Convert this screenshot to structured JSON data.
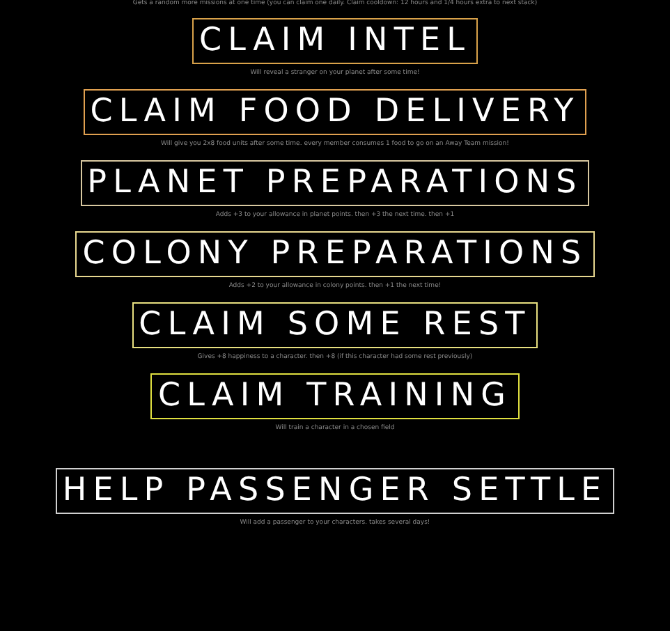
{
  "intro": "Gets a random more missions at one time (you can claim one daily. Claim cooldown: 12 hours and 1/4 hours extra to next stack)",
  "actions": [
    {
      "label": "CLAIM INTEL",
      "color": "#d9a24a",
      "description": "Will reveal a stranger on your planet after some time!"
    },
    {
      "label": "CLAIM FOOD DELIVERY",
      "color": "#e0a050",
      "description": "Will give you 2x8 food units after some time. every member consumes 1 food to go on an Away Team mission!"
    },
    {
      "label": "PLANET PREPARATIONS",
      "color": "#d8c8a0",
      "description": "Adds +3 to your allowance in planet points. then +3 the next time. then +1"
    },
    {
      "label": "COLONY PREPARATIONS",
      "color": "#e8d890",
      "description": "Adds +2 to your allowance in colony points. then +1 the next time!"
    },
    {
      "label": "CLAIM SOME REST",
      "color": "#e8e080",
      "description": "Gives +8 happiness to a character. then +8 (if this character had some rest previously)"
    },
    {
      "label": "CLAIM TRAINING",
      "color": "#e0e040",
      "description": "Will train a character in a chosen field"
    },
    {
      "label": "HELP PASSENGER SETTLE",
      "color": "#d0d0d0",
      "description": "Will add a passenger to your characters. takes several days!"
    }
  ]
}
